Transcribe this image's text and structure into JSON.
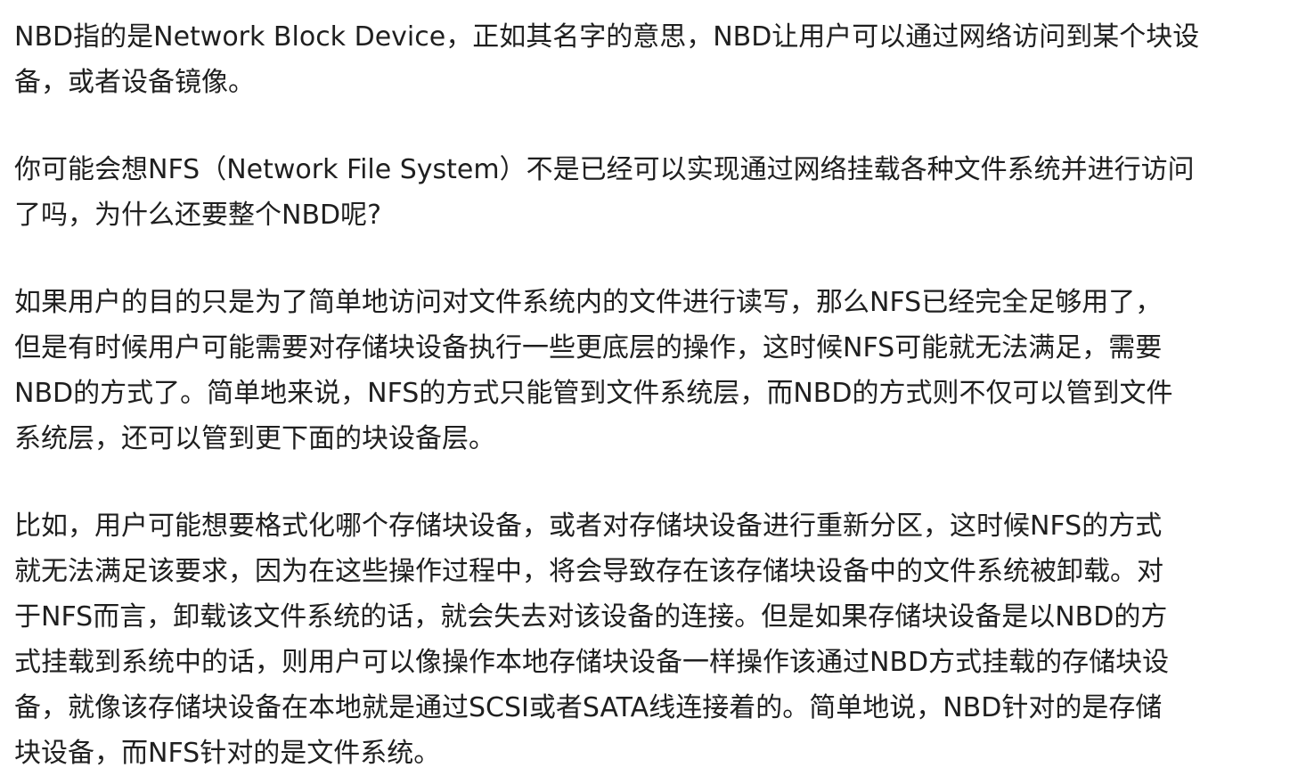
{
  "article": {
    "paragraphs": [
      {
        "lines": [
          "NBD指的是Network Block Device，正如其名字的意思，NBD让用户可以通过网络访问到某个块设",
          "备，或者设备镜像。"
        ]
      },
      {
        "lines": [
          "你可能会想NFS（Network File System）不是已经可以实现通过网络挂载各种文件系统并进行访问",
          "了吗，为什么还要整个NBD呢?"
        ]
      },
      {
        "lines": [
          "如果用户的目的只是为了简单地访问对文件系统内的文件进行读写，那么NFS已经完全足够用了，",
          "但是有时候用户可能需要对存储块设备执行一些更底层的操作，这时候NFS可能就无法满足，需要",
          "NBD的方式了。简单地来说，NFS的方式只能管到文件系统层，而NBD的方式则不仅可以管到文件",
          "系统层，还可以管到更下面的块设备层。"
        ]
      },
      {
        "lines": [
          "比如，用户可能想要格式化哪个存储块设备，或者对存储块设备进行重新分区，这时候NFS的方式",
          "就无法满足该要求，因为在这些操作过程中，将会导致存在该存储块设备中的文件系统被卸载。对",
          "于NFS而言，卸载该文件系统的话，就会失去对该设备的连接。但是如果存储块设备是以NBD的方",
          "式挂载到系统中的话，则用户可以像操作本地存储块设备一样操作该通过NBD方式挂载的存储块设",
          "备，就像该存储块设备在本地就是通过SCSI或者SATA线连接着的。简单地说，NBD针对的是存储",
          "块设备，而NFS针对的是文件系统。"
        ]
      }
    ]
  }
}
